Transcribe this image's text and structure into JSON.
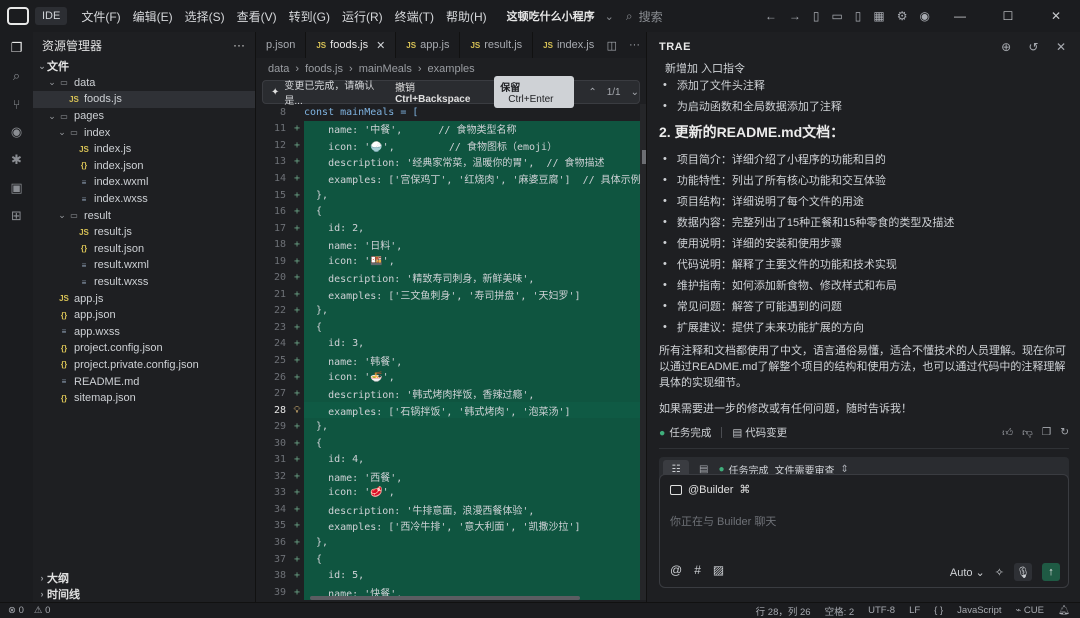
{
  "titlebar": {
    "logo_text": "IDE",
    "ide_label": "IDE",
    "menu": [
      "文件(F)",
      "编辑(E)",
      "选择(S)",
      "查看(V)",
      "转到(G)",
      "运行(R)",
      "终端(T)",
      "帮助(H)"
    ],
    "project_title": "这顿吃什么小程序",
    "search_placeholder": "搜索"
  },
  "activity_bar": {
    "icons": [
      "files-icon",
      "search-icon",
      "source-control-icon",
      "eye-icon",
      "debug-icon",
      "remote-icon",
      "extensions-icon"
    ]
  },
  "explorer": {
    "title": "资源管理器",
    "more": "···",
    "section": "文件",
    "tree": [
      {
        "label": "data",
        "type": "folder",
        "depth": 1,
        "open": true
      },
      {
        "label": "foods.js",
        "type": "js",
        "depth": 2,
        "selected": true
      },
      {
        "label": "pages",
        "type": "folder",
        "depth": 1,
        "open": true
      },
      {
        "label": "index",
        "type": "folder",
        "depth": 2,
        "open": true
      },
      {
        "label": "index.js",
        "type": "js",
        "depth": 3
      },
      {
        "label": "index.json",
        "type": "json",
        "depth": 3
      },
      {
        "label": "index.wxml",
        "type": "wx",
        "depth": 3
      },
      {
        "label": "index.wxss",
        "type": "wx",
        "depth": 3
      },
      {
        "label": "result",
        "type": "folder",
        "depth": 2,
        "open": true
      },
      {
        "label": "result.js",
        "type": "js",
        "depth": 3
      },
      {
        "label": "result.json",
        "type": "json",
        "depth": 3
      },
      {
        "label": "result.wxml",
        "type": "wx",
        "depth": 3
      },
      {
        "label": "result.wxss",
        "type": "wx",
        "depth": 3
      },
      {
        "label": "app.js",
        "type": "js",
        "depth": 1
      },
      {
        "label": "app.json",
        "type": "json",
        "depth": 1
      },
      {
        "label": "app.wxss",
        "type": "wx",
        "depth": 1
      },
      {
        "label": "project.config.json",
        "type": "json",
        "depth": 1
      },
      {
        "label": "project.private.config.json",
        "type": "json",
        "depth": 1
      },
      {
        "label": "README.md",
        "type": "wx",
        "depth": 1
      },
      {
        "label": "sitemap.json",
        "type": "json",
        "depth": 1
      }
    ],
    "bottom": [
      "大纲",
      "时间线"
    ]
  },
  "editor": {
    "tabs": [
      {
        "label": "p.json",
        "active": false,
        "icon": ""
      },
      {
        "label": "foods.js",
        "active": true,
        "icon": "JS"
      },
      {
        "label": "app.js",
        "active": false,
        "icon": "JS"
      },
      {
        "label": "result.js",
        "active": false,
        "icon": "JS"
      },
      {
        "label": "index.js",
        "active": false,
        "icon": "JS"
      }
    ],
    "breadcrumb": [
      "data",
      "foods.js",
      "mainMeals",
      "examples"
    ],
    "diff_bar": {
      "message": "变更已完成，请确认是...",
      "reject_label": "撤销",
      "reject_shortcut": "Ctrl+Backspace",
      "keep_label": "保留",
      "keep_shortcut": "Ctrl+Enter",
      "counter": "1/1"
    },
    "header_line": "const mainMeals = [",
    "header_line_no": "8",
    "lines": [
      {
        "no": "11",
        "code": "    name: '中餐',      // 食物类型名称",
        "added": true
      },
      {
        "no": "12",
        "code": "    icon: '🍚',         // 食物图标（emoji）",
        "added": true
      },
      {
        "no": "13",
        "code": "    description: '经典家常菜，温暖你的胃',  // 食物描述",
        "added": true
      },
      {
        "no": "14",
        "code": "    examples: ['宫保鸡丁', '红烧肉', '麻婆豆腐']  // 具体示例",
        "added": true
      },
      {
        "no": "15",
        "code": "  },",
        "added": true
      },
      {
        "no": "16",
        "code": "  {",
        "added": true
      },
      {
        "no": "17",
        "code": "    id: 2,",
        "added": true
      },
      {
        "no": "18",
        "code": "    name: '日料',",
        "added": true
      },
      {
        "no": "19",
        "code": "    icon: '🍱',",
        "added": true
      },
      {
        "no": "20",
        "code": "    description: '精致寿司刺身，新鲜美味',",
        "added": true
      },
      {
        "no": "21",
        "code": "    examples: ['三文鱼刺身', '寿司拼盘', '天妇罗']",
        "added": true
      },
      {
        "no": "22",
        "code": "  },",
        "added": true
      },
      {
        "no": "23",
        "code": "  {",
        "added": true
      },
      {
        "no": "24",
        "code": "    id: 3,",
        "added": true
      },
      {
        "no": "25",
        "code": "    name: '韩餐',",
        "added": true
      },
      {
        "no": "26",
        "code": "    icon: '🍜',",
        "added": true
      },
      {
        "no": "27",
        "code": "    description: '韩式烤肉拌饭，香辣过瘾',",
        "added": true
      },
      {
        "no": "28",
        "code": "    examples: ['石锅拌饭', '韩式烤肉', '泡菜汤']",
        "added": true,
        "current": true
      },
      {
        "no": "29",
        "code": "  },",
        "added": true
      },
      {
        "no": "30",
        "code": "  {",
        "added": true
      },
      {
        "no": "31",
        "code": "    id: 4,",
        "added": true
      },
      {
        "no": "32",
        "code": "    name: '西餐',",
        "added": true
      },
      {
        "no": "33",
        "code": "    icon: '🥩',",
        "added": true
      },
      {
        "no": "34",
        "code": "    description: '牛排意面，浪漫西餐体验',",
        "added": true
      },
      {
        "no": "35",
        "code": "    examples: ['西冷牛排', '意大利面', '凯撒沙拉']",
        "added": true
      },
      {
        "no": "36",
        "code": "  },",
        "added": true
      },
      {
        "no": "37",
        "code": "  {",
        "added": true
      },
      {
        "no": "38",
        "code": "    id: 5,",
        "added": true
      },
      {
        "no": "39",
        "code": "    name: '快餐',",
        "added": true
      }
    ]
  },
  "ai_panel": {
    "title": "TRAE",
    "top_clip": "新增加 入口指令",
    "bullets_a": [
      "添加了文件头注释",
      "为启动函数和全局数据添加了注释"
    ],
    "section_title": "2. 更新的README.md文档：",
    "bullets_b": [
      "项目简介：详细介绍了小程序的功能和目的",
      "功能特性：列出了所有核心功能和交互体验",
      "项目结构：详细说明了每个文件的用途",
      "数据内容：完整列出了15种正餐和15种零食的类型及描述",
      "使用说明：详细的安装和使用步骤",
      "代码说明：解释了主要文件的功能和技术实现",
      "维护指南：如何添加新食物、修改样式和布局",
      "常见问题：解答了可能遇到的问题",
      "扩展建议：提供了未来功能扩展的方向"
    ],
    "summary": "所有注释和文档都使用了中文，语言通俗易懂，适合不懂技术的人员理解。现在你可以通过README.md了解整个项目的结构和使用方法，也可以通过代码中的注释理解具体的实现细节。",
    "followup": "如果需要进一步的修改或有任何问题，随时告诉我！",
    "task_done": "任务完成",
    "code_changes": "代码变更",
    "chip_task": "任务完成",
    "chip_files": "文件需要审查",
    "input_mention": "@Builder",
    "input_placeholder": "你正在与 Builder 聊天",
    "mode": "Auto"
  },
  "statusbar": {
    "errors": "0",
    "warnings": "0",
    "position": "行 28，列 26",
    "spaces": "空格: 2",
    "encoding": "UTF-8",
    "eol": "LF",
    "braces": "{ }",
    "language": "JavaScript",
    "cue": "CUE"
  }
}
